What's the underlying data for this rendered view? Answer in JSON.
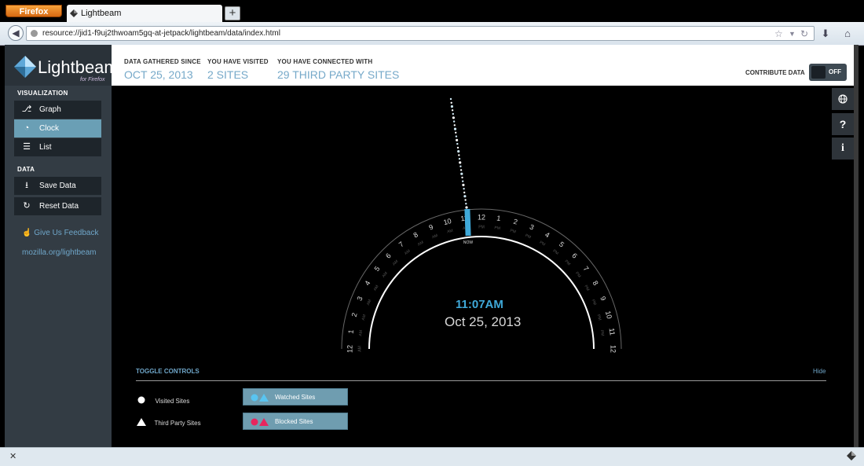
{
  "browser": {
    "menu_button": "Firefox",
    "tab_title": "Lightbeam",
    "new_tab": "+",
    "url": "resource://jid1-f9uj2thwoam5gq-at-jetpack/lightbeam/data/index.html"
  },
  "sidebar": {
    "logo_title": "Lightbeam",
    "logo_subtitle": "for Firefox",
    "visualization_title": "VISUALIZATION",
    "viz_items": [
      {
        "label": "Graph",
        "icon": "graph-icon"
      },
      {
        "label": "Clock",
        "icon": "clock-icon",
        "active": true
      },
      {
        "label": "List",
        "icon": "list-icon"
      }
    ],
    "data_title": "DATA",
    "data_items": [
      {
        "label": "Save Data",
        "icon": "download-icon"
      },
      {
        "label": "Reset Data",
        "icon": "reset-icon"
      }
    ],
    "feedback_label": "Give Us Feedback",
    "mozilla_link": "mozilla.org/lightbeam"
  },
  "header": {
    "since_label": "DATA GATHERED SINCE",
    "since_value": "OCT 25, 2013",
    "visited_label": "YOU HAVE VISITED",
    "visited_value": "2 SITES",
    "connected_label": "YOU HAVE CONNECTED WITH",
    "connected_value": "29 THIRD PARTY SITES",
    "contribute_label": "CONTRIBUTE DATA",
    "contribute_state": "OFF"
  },
  "clock": {
    "time": "11:07AM",
    "date": "Oct 25, 2013",
    "now_label": "NOW",
    "am_label": "AM",
    "pm_label": "PM",
    "am_hours": [
      "12",
      "1",
      "2",
      "3",
      "4",
      "5",
      "6",
      "7",
      "8",
      "9",
      "10",
      "11"
    ],
    "pm_hours": [
      "12",
      "1",
      "2",
      "3",
      "4",
      "5",
      "6",
      "7",
      "8",
      "9",
      "10",
      "11",
      "12"
    ],
    "accent_color": "#3fa9d9"
  },
  "toggles": {
    "title": "TOGGLE CONTROLS",
    "hide_label": "Hide",
    "visited_sites": "Visited Sites",
    "third_party_sites": "Third Party Sites",
    "watched_sites": "Watched Sites",
    "blocked_sites": "Blocked Sites",
    "watched_color": "#59c4f0",
    "blocked_color": "#e8255e"
  }
}
